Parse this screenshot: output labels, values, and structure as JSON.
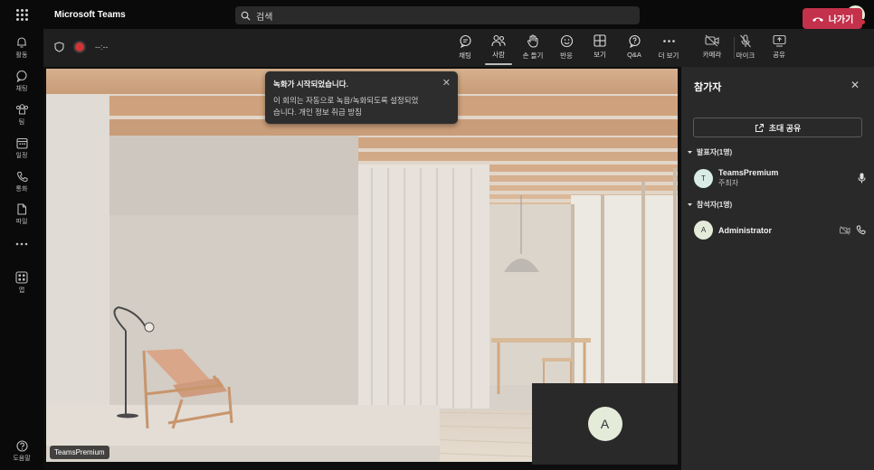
{
  "app": {
    "title": "Microsoft Teams"
  },
  "search": {
    "placeholder": "검색"
  },
  "topbar": {
    "more": "···",
    "avatar_initial": "A"
  },
  "rail": [
    {
      "label": "활동",
      "icon": "bell-icon"
    },
    {
      "label": "채팅",
      "icon": "chat-icon"
    },
    {
      "label": "팀",
      "icon": "teams-icon"
    },
    {
      "label": "일정",
      "icon": "calendar-icon"
    },
    {
      "label": "통화",
      "icon": "phone-icon"
    },
    {
      "label": "파일",
      "icon": "file-icon"
    },
    {
      "label": "",
      "icon": "more-icon"
    },
    {
      "label": "앱",
      "icon": "apps-icon"
    },
    {
      "label": "도움말",
      "icon": "help-icon"
    }
  ],
  "meeting": {
    "timer": "--:--",
    "toolbar": {
      "chat": "채팅",
      "people": "사람",
      "raise_hand": "손 들기",
      "react": "반응",
      "view": "보기",
      "qa": "Q&A",
      "more": "더 보기",
      "camera": "카메라",
      "mic": "마이크",
      "share": "공유"
    },
    "leave_label": "나가기"
  },
  "toast": {
    "title": "녹화가 시작되었습니다.",
    "body_line1": "이 회의는 자동으로 녹음/녹화되도록 설정되었",
    "body_line2": "습니다. 개인 정보 취급 방침"
  },
  "stage": {
    "nametag": "TeamsPremium",
    "self_initial": "A"
  },
  "panel": {
    "title": "참가자",
    "invite_label": "초대 공유",
    "presenters_label": "발표자(1명)",
    "attendees_label": "참석자(1명)",
    "presenter": {
      "initial": "T",
      "name": "TeamsPremium",
      "role": "주최자"
    },
    "attendee": {
      "initial": "A",
      "name": "Administrator"
    }
  },
  "colors": {
    "leave": "#c4314b",
    "recording": "#d13438",
    "avatar_bg": "#e4ebd8"
  }
}
